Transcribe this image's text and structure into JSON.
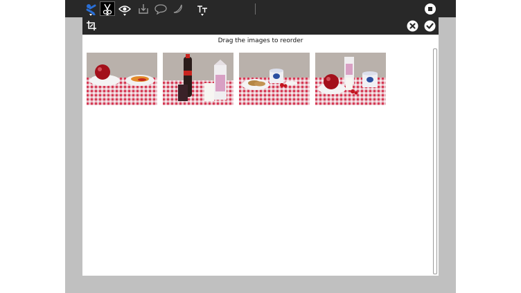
{
  "dialog": {
    "title": "Drag the images to reorder"
  },
  "toolbar": {
    "buttons": [
      {
        "name": "activity-icon"
      },
      {
        "name": "cut-icon",
        "active": true
      },
      {
        "name": "view-icon"
      },
      {
        "name": "import-icon"
      },
      {
        "name": "speech-bubble-icon"
      },
      {
        "name": "banana-icon"
      },
      {
        "name": "text-size-icon"
      },
      {
        "name": "stop-icon"
      }
    ]
  },
  "header_icons": [
    "crop-icon",
    "cancel-icon",
    "accept-icon"
  ],
  "images": [
    {
      "name": "apple-and-fries-image"
    },
    {
      "name": "cola-and-milk-image"
    },
    {
      "name": "cookies-and-yogurt-image"
    },
    {
      "name": "apple-and-yogurt-image"
    }
  ],
  "colors": {
    "bar": "#282828",
    "frame": "#c0c0c0",
    "accent": "#2a6fd6"
  }
}
